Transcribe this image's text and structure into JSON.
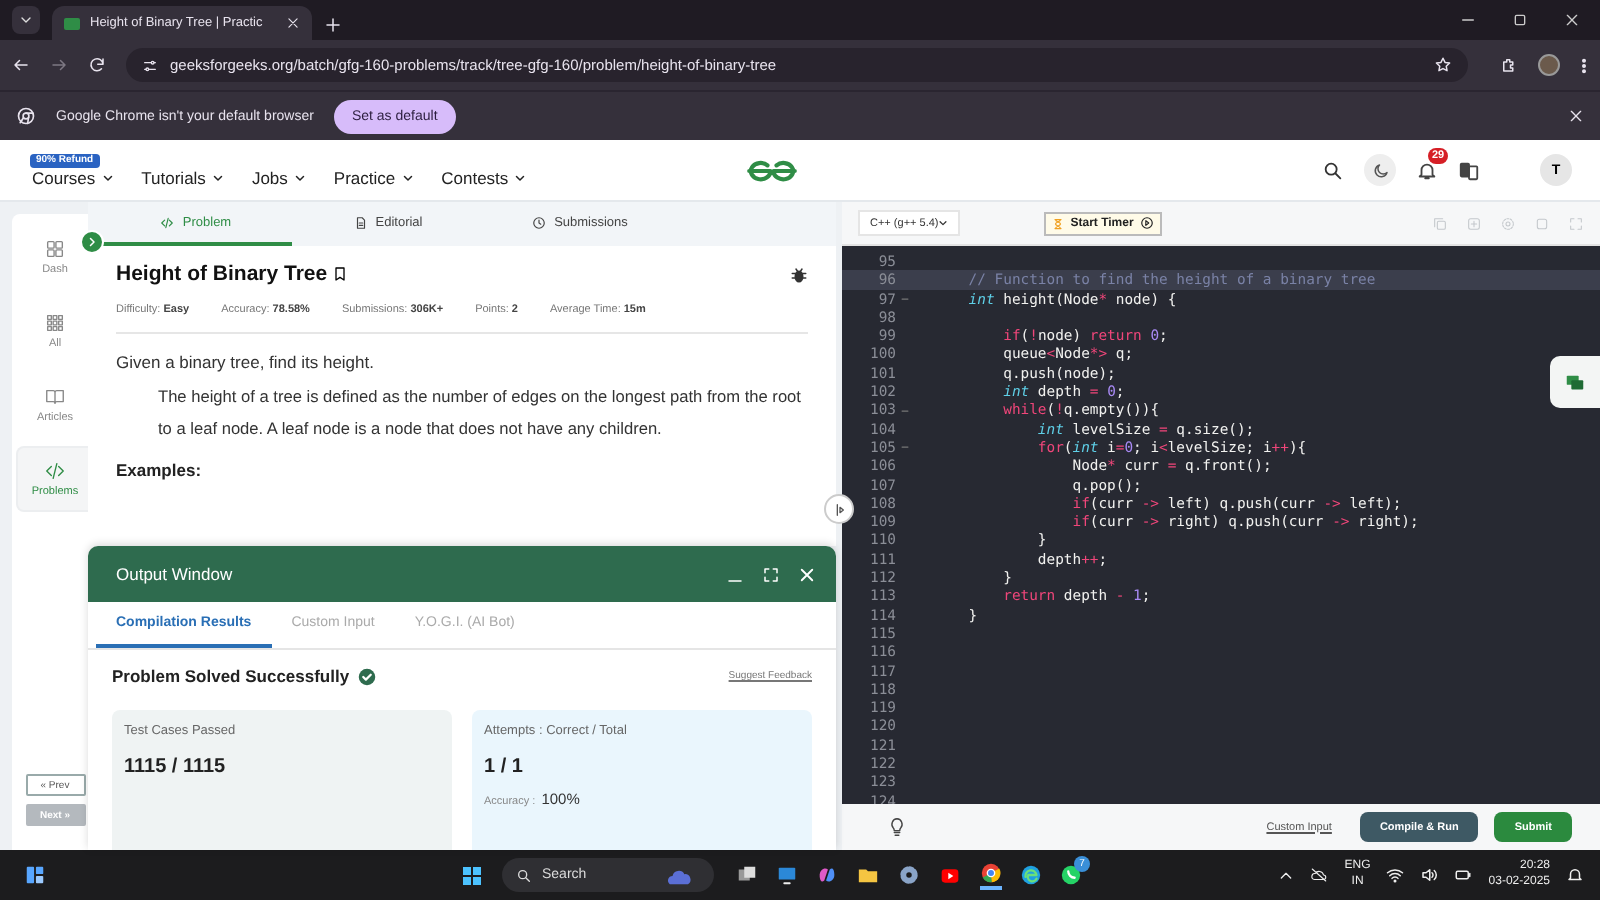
{
  "browser": {
    "tab": {
      "title": "Height of Binary Tree | Practic",
      "selected": true
    },
    "address": "geeksforgeeks.org/batch/gfg-160-problems/track/tree-gfg-160/problem/height-of-binary-tree",
    "infobar": {
      "message": "Google Chrome isn't your default browser",
      "button": "Set as default"
    }
  },
  "site_header": {
    "badge": "90% Refund",
    "nav": [
      "Courses",
      "Tutorials",
      "Jobs",
      "Practice",
      "Contests"
    ],
    "notification_count": "29",
    "avatar": "T"
  },
  "sidebar": {
    "items": [
      {
        "label": "Dash",
        "kind": "dash",
        "selected": false
      },
      {
        "label": "All",
        "kind": "all",
        "selected": false
      },
      {
        "label": "Articles",
        "kind": "articles",
        "selected": false
      },
      {
        "label": "Problems",
        "kind": "problems",
        "selected": true
      }
    ],
    "prev": {
      "label": "« Prev",
      "disabled": false
    },
    "next": {
      "label": "Next »",
      "disabled": true
    }
  },
  "problem": {
    "tabs": [
      {
        "label": "Problem",
        "kind": "code",
        "selected": true
      },
      {
        "label": "Editorial",
        "kind": "document",
        "selected": false
      },
      {
        "label": "Submissions",
        "kind": "clock",
        "selected": false
      }
    ],
    "title": "Height of Binary Tree",
    "meta": [
      "Difficulty: **Easy**",
      "Accuracy: **78.58%**",
      "Submissions: **306K+**",
      "Points: **2**",
      "Average Time: **15m**"
    ],
    "description": "Given a binary tree, find its height.",
    "definition": "The height of a tree is defined as the number of edges on the longest path from the root to a leaf node. A leaf node is a node that does not have any children.",
    "examples_heading": "Examples:"
  },
  "output_window": {
    "title": "Output Window",
    "tabs": [
      {
        "label": "Compilation Results",
        "selected": true
      },
      {
        "label": "Custom Input",
        "selected": false
      },
      {
        "label": "Y.O.G.I. (AI Bot)",
        "selected": false
      }
    ],
    "status": "Problem Solved Successfully",
    "feedback_link": "Suggest Feedback",
    "test_cases": {
      "label": "Test Cases Passed",
      "value": "1115 / 1115"
    },
    "attempts": {
      "label": "Attempts : Correct / Total",
      "value": "1 / 1",
      "accuracy_label": "Accuracy :",
      "accuracy_value": "100%"
    }
  },
  "editor": {
    "language": "C++ (g++ 5.4)",
    "timer_button": "Start Timer",
    "lines": [
      {
        "number": "95",
        "current": false,
        "foldable": false
      },
      {
        "number": "96",
        "current": true,
        "foldable": false,
        "tokens": [
          {
            "kind": "comment",
            "text": "    // Function to find the height of a binary tree"
          }
        ]
      },
      {
        "number": "97",
        "current": false,
        "foldable": true,
        "tokens": [
          {
            "kind": "type",
            "text": "    int"
          },
          {
            "kind": "plain",
            "text": " height(Node"
          },
          {
            "kind": "operator",
            "text": "*"
          },
          {
            "kind": "plain",
            "text": " node) {"
          }
        ]
      },
      {
        "number": "98",
        "current": false,
        "foldable": false
      },
      {
        "number": "99",
        "current": false,
        "foldable": false,
        "tokens": [
          {
            "kind": "keyword",
            "text": "        if"
          },
          {
            "kind": "plain",
            "text": "("
          },
          {
            "kind": "operator",
            "text": "!"
          },
          {
            "kind": "plain",
            "text": "node) "
          },
          {
            "kind": "keyword",
            "text": "return "
          },
          {
            "kind": "number",
            "text": "0"
          },
          {
            "kind": "plain",
            "text": ";"
          }
        ]
      },
      {
        "number": "100",
        "current": false,
        "foldable": false,
        "tokens": [
          {
            "kind": "plain",
            "text": "        queue"
          },
          {
            "kind": "operator",
            "text": "<"
          },
          {
            "kind": "plain",
            "text": "Node"
          },
          {
            "kind": "operator",
            "text": "*>"
          },
          {
            "kind": "plain",
            "text": " q;"
          }
        ]
      },
      {
        "number": "101",
        "current": false,
        "foldable": false,
        "tokens": [
          {
            "kind": "plain",
            "text": "        q.push(node);"
          }
        ]
      },
      {
        "number": "102",
        "current": false,
        "foldable": false,
        "tokens": [
          {
            "kind": "type",
            "text": "        int"
          },
          {
            "kind": "plain",
            "text": " depth "
          },
          {
            "kind": "operator",
            "text": "= "
          },
          {
            "kind": "number",
            "text": "0"
          },
          {
            "kind": "plain",
            "text": ";"
          }
        ]
      },
      {
        "number": "103",
        "current": false,
        "foldable": true,
        "tokens": [
          {
            "kind": "keyword",
            "text": "        while"
          },
          {
            "kind": "plain",
            "text": "("
          },
          {
            "kind": "operator",
            "text": "!"
          },
          {
            "kind": "plain",
            "text": "q.empty()){"
          }
        ]
      },
      {
        "number": "104",
        "current": false,
        "foldable": false,
        "tokens": [
          {
            "kind": "type",
            "text": "            int"
          },
          {
            "kind": "plain",
            "text": " levelSize "
          },
          {
            "kind": "operator",
            "text": "="
          },
          {
            "kind": "plain",
            "text": " q.size();"
          }
        ]
      },
      {
        "number": "105",
        "current": false,
        "foldable": true,
        "tokens": [
          {
            "kind": "keyword",
            "text": "            for"
          },
          {
            "kind": "plain",
            "text": "("
          },
          {
            "kind": "type",
            "text": "int"
          },
          {
            "kind": "plain",
            "text": " i"
          },
          {
            "kind": "operator",
            "text": "="
          },
          {
            "kind": "number",
            "text": "0"
          },
          {
            "kind": "plain",
            "text": "; i"
          },
          {
            "kind": "operator",
            "text": "<"
          },
          {
            "kind": "plain",
            "text": "levelSize; i"
          },
          {
            "kind": "operator",
            "text": "++"
          },
          {
            "kind": "plain",
            "text": "){"
          }
        ]
      },
      {
        "number": "106",
        "current": false,
        "foldable": false,
        "tokens": [
          {
            "kind": "plain",
            "text": "                Node"
          },
          {
            "kind": "operator",
            "text": "*"
          },
          {
            "kind": "plain",
            "text": " curr "
          },
          {
            "kind": "operator",
            "text": "="
          },
          {
            "kind": "plain",
            "text": " q.front();"
          }
        ]
      },
      {
        "number": "107",
        "current": false,
        "foldable": false,
        "tokens": [
          {
            "kind": "plain",
            "text": "                q.pop();"
          }
        ]
      },
      {
        "number": "108",
        "current": false,
        "foldable": false,
        "tokens": [
          {
            "kind": "keyword",
            "text": "                if"
          },
          {
            "kind": "plain",
            "text": "(curr "
          },
          {
            "kind": "operator",
            "text": "->"
          },
          {
            "kind": "plain",
            "text": " left) q.push(curr "
          },
          {
            "kind": "operator",
            "text": "->"
          },
          {
            "kind": "plain",
            "text": " left);"
          }
        ]
      },
      {
        "number": "109",
        "current": false,
        "foldable": false,
        "tokens": [
          {
            "kind": "keyword",
            "text": "                if"
          },
          {
            "kind": "plain",
            "text": "(curr "
          },
          {
            "kind": "operator",
            "text": "->"
          },
          {
            "kind": "plain",
            "text": " right) q.push(curr "
          },
          {
            "kind": "operator",
            "text": "->"
          },
          {
            "kind": "plain",
            "text": " right);"
          }
        ]
      },
      {
        "number": "110",
        "current": false,
        "foldable": false,
        "tokens": [
          {
            "kind": "plain",
            "text": "            }"
          }
        ]
      },
      {
        "number": "111",
        "current": false,
        "foldable": false,
        "tokens": [
          {
            "kind": "plain",
            "text": "            depth"
          },
          {
            "kind": "operator",
            "text": "++"
          },
          {
            "kind": "plain",
            "text": ";"
          }
        ]
      },
      {
        "number": "112",
        "current": false,
        "foldable": false,
        "tokens": [
          {
            "kind": "plain",
            "text": "        }"
          }
        ]
      },
      {
        "number": "113",
        "current": false,
        "foldable": false,
        "tokens": [
          {
            "kind": "keyword",
            "text": "        return"
          },
          {
            "kind": "plain",
            "text": " depth "
          },
          {
            "kind": "operator",
            "text": "- "
          },
          {
            "kind": "number",
            "text": "1"
          },
          {
            "kind": "plain",
            "text": ";"
          }
        ]
      },
      {
        "number": "114",
        "current": false,
        "foldable": false,
        "tokens": [
          {
            "kind": "plain",
            "text": "    }"
          }
        ]
      },
      {
        "number": "115",
        "current": false,
        "foldable": false
      },
      {
        "number": "116",
        "current": false,
        "foldable": false
      },
      {
        "number": "117",
        "current": false,
        "foldable": false
      },
      {
        "number": "118",
        "current": false,
        "foldable": false
      },
      {
        "number": "119",
        "current": false,
        "foldable": false
      },
      {
        "number": "120",
        "current": false,
        "foldable": false
      },
      {
        "number": "121",
        "current": false,
        "foldable": false
      },
      {
        "number": "122",
        "current": false,
        "foldable": false
      },
      {
        "number": "123",
        "current": false,
        "foldable": false
      },
      {
        "number": "124",
        "current": false,
        "foldable": false
      }
    ],
    "custom_input": "Custom Input",
    "compile_button": "Compile & Run",
    "submit_button": "Submit"
  },
  "taskbar": {
    "search_placeholder": "Search",
    "whatsapp_badge": "7",
    "language": "ENG",
    "region": "IN",
    "time": "20:28",
    "date": "03-02-2025"
  }
}
